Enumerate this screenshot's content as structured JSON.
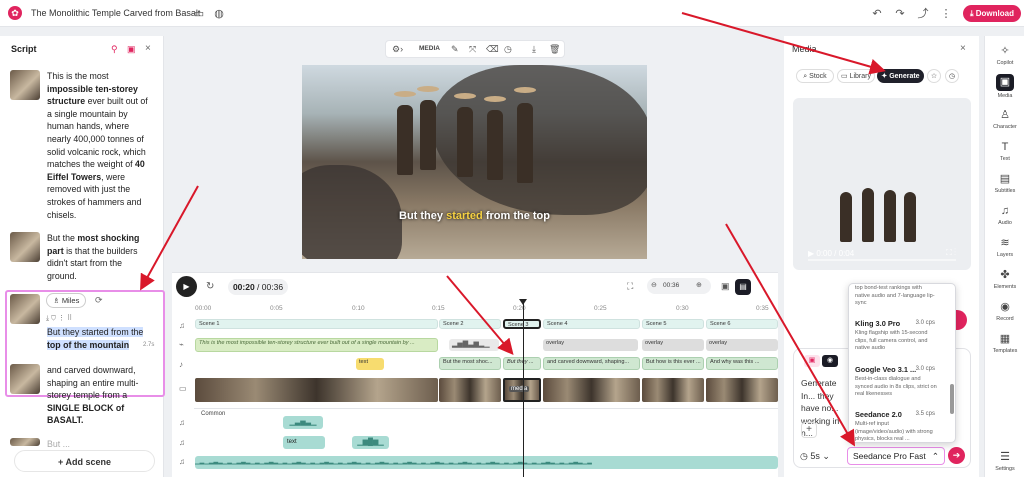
{
  "topbar": {
    "title": "The Monolithic Temple Carved from Basalt",
    "download": "Download"
  },
  "script": {
    "title": "Script",
    "scene1": {
      "t1": "This is the most ",
      "b1": "impossible ten-storey structure",
      "t2": " ever built out of a single mountain by human hands, where nearly 400,000 tonnes of solid volcanic rock, which matches the weight of ",
      "b2": "40 Eiffel Towers",
      "t3": ", were removed with just the strokes of hammers and chisels."
    },
    "scene2": {
      "t1": "But the ",
      "b1": "most shocking part",
      "t2": " is that the builders didn't start from the ground."
    },
    "scene3": {
      "voice": "Miles",
      "sel": "But they started from the ",
      "sel2": "top of the mountain",
      "dur": "2.7s"
    },
    "scene4": {
      "t1": "and carved downward, shaping an entire multi-storey temple from a ",
      "b1": "SINGLE BLOCK of BASALT."
    },
    "scene5": {
      "t1": "But ..."
    },
    "add_scene": "Add scene"
  },
  "toolbar": {
    "media": "MEDIA"
  },
  "preview": {
    "caption_a": "But they ",
    "caption_hl": "started",
    "caption_b": " from the top"
  },
  "timeline": {
    "time": "00:20",
    "total": "00:36",
    "zoom": "00:36",
    "ticks": [
      "00:00",
      "0:05",
      "0:10",
      "0:15",
      "0:20",
      "0:25",
      "0:30",
      "0:35"
    ],
    "scenes": [
      "Scene 1",
      "Scene 2",
      "Scene 3",
      "Scene 4",
      "Scene 5",
      "Scene 6"
    ],
    "text1": "This is the most impossible ten-storey structure ever built out of a single mountain by ...",
    "text2": "But the most shoc...",
    "text3": "But they ...",
    "text4": "and carved downward, shaping...",
    "text5": "But how is this ever ...",
    "text6": "And why was this ...",
    "overlay": "overlay",
    "text_label": "text",
    "media_label": "media",
    "common": "Common"
  },
  "media": {
    "title": "Media",
    "tabs": {
      "stock": "Stock",
      "library": "Library",
      "generate": "Generate"
    },
    "video_time": "0:00 / 0:04",
    "prompt_text": "Generate In... they have no... working in n...",
    "duration": "5s",
    "model": "Seedance Pro Fast",
    "options": [
      {
        "name": "",
        "cps": "",
        "desc": "top bond-test rankings with native audio and 7-language lip-sync"
      },
      {
        "name": "Kling 3.0 Pro",
        "cps": "3.0 cps",
        "desc": "Kling flagship with 15-second clips, full camera control, and native audio"
      },
      {
        "name": "Google Veo 3.1 ...",
        "cps": "3.0 cps",
        "desc": "Best-in-class dialogue and synced audio in 8s clips, strict on real likenesses"
      },
      {
        "name": "Seedance 2.0",
        "cps": "3.5 cps",
        "desc": "Multi-ref input (image/video/audio) with strong physics, blocks real ..."
      }
    ]
  },
  "rail": [
    "Copilot",
    "Media",
    "Character",
    "Text",
    "Subtitles",
    "Audio",
    "Layers",
    "Elements",
    "Record",
    "Templates",
    "Settings"
  ],
  "colors": {
    "accent": "#e0245e",
    "highlight_border": "#e88ee8",
    "arrow": "#d9182a"
  }
}
